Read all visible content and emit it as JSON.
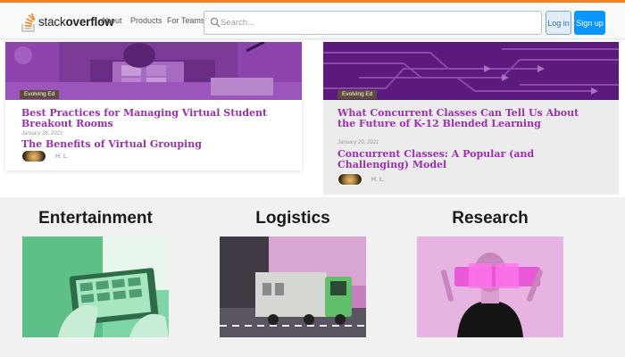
{
  "nav": {
    "logo_prefix": "stack",
    "logo_suffix": "overflow",
    "links": [
      "About",
      "Products",
      "For Teams"
    ],
    "search_placeholder": "Search...",
    "login_label": "Log in",
    "signup_label": "Sign up",
    "accent_color": "#f48024",
    "primary_button_color": "#0a95ff"
  },
  "blog": {
    "left_card": {
      "tag": "Evolving Ed",
      "title": "Best Practices for Managing Virtual Student Breakout Rooms",
      "date": "January 26, 2021",
      "second_title": "The Benefits of Virtual Grouping",
      "author": "H. L."
    },
    "right_card": {
      "tag": "Evolving Ed",
      "title": "What Concurrent Classes Can Tell Us About the Future of K-12 Blended Learning",
      "date": "January 20, 2021",
      "second_title": "Concurrent Classes: A Popular (and Challenging) Model",
      "author": "H. L."
    },
    "title_color": "#9b2fae"
  },
  "categories": [
    "Entertainment",
    "Logistics",
    "Research"
  ]
}
